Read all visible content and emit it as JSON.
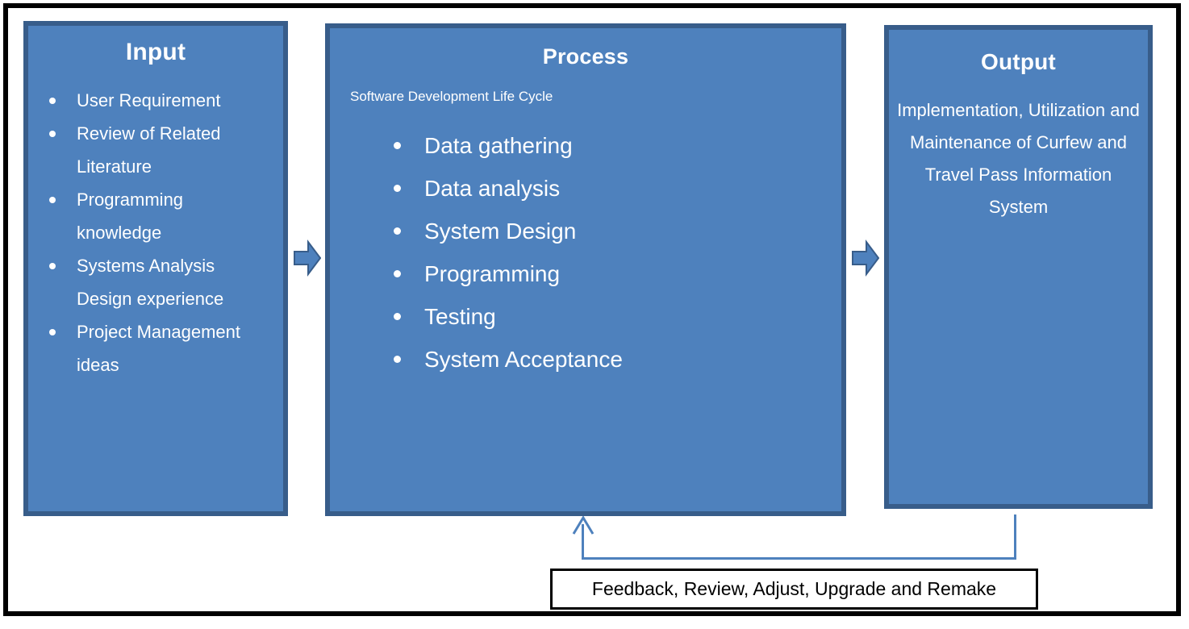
{
  "diagram": {
    "type": "input-process-output",
    "colors": {
      "panel_fill": "#4E81BD",
      "panel_border": "#385D8A",
      "frame": "#000000",
      "text_on_panel": "#FFFFFF",
      "connector": "#4E81BD"
    }
  },
  "input": {
    "title": "Input",
    "items": [
      "User Requirement",
      "Review of Related Literature",
      "Programming knowledge",
      "Systems Analysis Design experience",
      "Project Management ideas"
    ]
  },
  "process": {
    "title": "Process",
    "subtitle": "Software Development  Life Cycle",
    "items": [
      "Data gathering",
      "Data analysis",
      "System Design",
      "Programming",
      "Testing",
      "System Acceptance"
    ]
  },
  "output": {
    "title": "Output",
    "text": "Implementation, Utilization and Maintenance of Curfew and Travel Pass Information System"
  },
  "feedback": {
    "text": "Feedback, Review, Adjust, Upgrade and Remake"
  },
  "connectors": {
    "input_to_process": "right-block-arrow",
    "process_to_output": "right-block-arrow",
    "feedback_loop": "output-to-process-up-arrow"
  }
}
